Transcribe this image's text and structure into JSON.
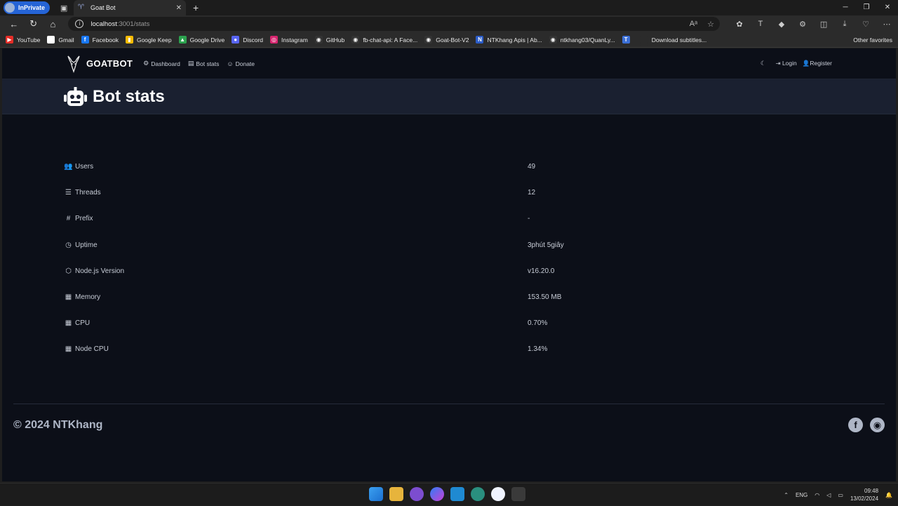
{
  "browser": {
    "inprivate_label": "InPrivate",
    "tab_title": "Goat Bot",
    "url_host": "localhost",
    "url_path": ":3001/stats"
  },
  "bookmarks": [
    {
      "label": "YouTube",
      "color": "#e52d27",
      "glyph": "▶"
    },
    {
      "label": "Gmail",
      "color": "#ffffff",
      "glyph": "G"
    },
    {
      "label": "Facebook",
      "color": "#1877f2",
      "glyph": "f"
    },
    {
      "label": "Google Keep",
      "color": "#f9bb04",
      "glyph": "▮"
    },
    {
      "label": "Google Drive",
      "color": "#2ca34f",
      "glyph": "▲"
    },
    {
      "label": "Discord",
      "color": "#5865f2",
      "glyph": "●"
    },
    {
      "label": "Instagram",
      "color": "#d6246e",
      "glyph": "◎"
    },
    {
      "label": "GitHub",
      "color": "#333333",
      "glyph": "◉"
    },
    {
      "label": "fb-chat-api: A Face...",
      "color": "#333333",
      "glyph": "◉"
    },
    {
      "label": "Goat-Bot-V2",
      "color": "#333333",
      "glyph": "◉"
    },
    {
      "label": "NTKhang Apis | Ab...",
      "color": "#2b5cc7",
      "glyph": "N"
    },
    {
      "label": "ntkhang03/QuanLy...",
      "color": "#333333",
      "glyph": "◉"
    },
    {
      "label": "",
      "color": "#3b6fd6",
      "glyph": "T"
    },
    {
      "label": "Download subtitles...",
      "color": "#2b2b2b",
      "glyph": ""
    }
  ],
  "bookmarks_other": "Other favorites",
  "site": {
    "brand": "GOATBOT",
    "nav": [
      {
        "label": "Dashboard",
        "icon": "⚙"
      },
      {
        "label": "Bot stats",
        "icon": "▤"
      },
      {
        "label": "Donate",
        "icon": "☺"
      }
    ],
    "login_label": "Login",
    "register_label": "Register",
    "page_title": "Bot stats"
  },
  "stats": [
    {
      "label": "Users",
      "value": "49",
      "icon": "users-icon",
      "glyph": "👥"
    },
    {
      "label": "Threads",
      "value": "12",
      "icon": "threads-icon",
      "glyph": "☰"
    },
    {
      "label": "Prefix",
      "value": "-",
      "icon": "hashtag-icon",
      "glyph": "#"
    },
    {
      "label": "Uptime",
      "value": "3phút 5giây",
      "icon": "clock-icon",
      "glyph": "◷"
    },
    {
      "label": "Node.js Version",
      "value": "v16.20.0",
      "icon": "nodejs-icon",
      "glyph": "⬡"
    },
    {
      "label": "Memory",
      "value": "153.50 MB",
      "icon": "memory-icon",
      "glyph": "▦"
    },
    {
      "label": "CPU",
      "value": "0.70%",
      "icon": "cpu-icon",
      "glyph": "▦"
    },
    {
      "label": "Node CPU",
      "value": "1.34%",
      "icon": "node-cpu-icon",
      "glyph": "▦"
    }
  ],
  "footer": {
    "copyright": "© 2024 NTKhang"
  },
  "taskbar": {
    "lang": "ENG",
    "time": "09:48",
    "date": "13/02/2024"
  }
}
